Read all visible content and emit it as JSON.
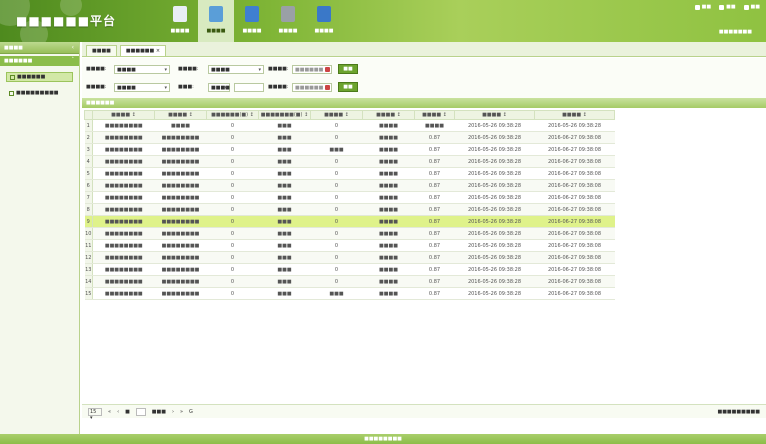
{
  "app": {
    "title": "■■■■■■平台"
  },
  "nav": [
    {
      "label": "■■■■",
      "icon": "document-icon",
      "color": "#e9eef6",
      "active": false
    },
    {
      "label": "■■■■",
      "icon": "bottles-icon",
      "color": "#5a9ed8",
      "active": true
    },
    {
      "label": "■■■■",
      "icon": "book-icon",
      "color": "#3f7fd0",
      "active": false
    },
    {
      "label": "■■■■",
      "icon": "gear-icon",
      "color": "#9aa0a6",
      "active": false
    },
    {
      "label": "■■■■",
      "icon": "shield-icon",
      "color": "#3a78c8",
      "active": false
    }
  ],
  "top_right": [
    {
      "label": "■■"
    },
    {
      "label": "■■"
    },
    {
      "label": "■■"
    }
  ],
  "user_info": "■■■■■■■",
  "sidebar": {
    "header": "■■■■",
    "sub": "■■■■■■",
    "items": [
      {
        "label": "■■■■■■",
        "active": true
      },
      {
        "label": "■■■■■■■■■",
        "active": false
      }
    ]
  },
  "tabs": [
    {
      "label": "■■■■",
      "active": false
    },
    {
      "label": "■■■■■■ ×",
      "active": true
    }
  ],
  "filters": {
    "row1": {
      "l1": "■■■■:",
      "v1": "■■■■",
      "l2": "■■■■:",
      "v2": "■■■■",
      "l3": "■■■■:",
      "p3": "■■■■■■",
      "btn": "■■"
    },
    "row2": {
      "l1": "■■■■:",
      "v1": "■■■■",
      "l2": "■■■:",
      "v2": "■■■■",
      "l3": "■■■■:",
      "p3": "■■■■■■",
      "btn": "■■"
    }
  },
  "section_title": "■■■■■■",
  "columns": [
    "■■■■ ↕",
    "■■■■ ↕",
    "■■■■■■(■) ↕",
    "■■■■■■■(■) ↕",
    "■■■■ ↕",
    "■■■■ ↕",
    "■■■■ ↕",
    "■■■■ ↕",
    "■■■■ ↕"
  ],
  "rows": [
    [
      "■■■■■■■■",
      "■■■■",
      "0",
      "■■■",
      "0",
      "■■■■",
      "■■■■",
      "2016-05-26 09:38:28",
      "2016-05-26 09:38:28"
    ],
    [
      "■■■■■■■■",
      "■■■■■■■■",
      "0",
      "■■■",
      "0",
      "■■■■",
      "0.87",
      "2016-05-26 09:38:28",
      "2016-06-27 09:38:08"
    ],
    [
      "■■■■■■■■",
      "■■■■■■■■",
      "0",
      "■■■",
      "■■■",
      "■■■■",
      "0.87",
      "2016-05-26 09:38:28",
      "2016-06-27 09:38:08"
    ],
    [
      "■■■■■■■■",
      "■■■■■■■■",
      "0",
      "■■■",
      "0",
      "■■■■",
      "0.87",
      "2016-05-26 09:38:28",
      "2016-06-27 09:38:08"
    ],
    [
      "■■■■■■■■",
      "■■■■■■■■",
      "0",
      "■■■",
      "0",
      "■■■■",
      "0.87",
      "2016-05-26 09:38:28",
      "2016-06-27 09:38:08"
    ],
    [
      "■■■■■■■■",
      "■■■■■■■■",
      "0",
      "■■■",
      "0",
      "■■■■",
      "0.87",
      "2016-05-26 09:38:28",
      "2016-06-27 09:38:08"
    ],
    [
      "■■■■■■■■",
      "■■■■■■■■",
      "0",
      "■■■",
      "0",
      "■■■■",
      "0.87",
      "2016-05-26 09:38:28",
      "2016-06-27 09:38:08"
    ],
    [
      "■■■■■■■■",
      "■■■■■■■■",
      "0",
      "■■■",
      "0",
      "■■■■",
      "0.87",
      "2016-05-26 09:38:28",
      "2016-06-27 09:38:08"
    ],
    [
      "■■■■■■■■",
      "■■■■■■■■",
      "0",
      "■■■",
      "0",
      "■■■■",
      "0.87",
      "2016-05-26 09:38:28",
      "2016-06-27 09:38:08"
    ],
    [
      "■■■■■■■■",
      "■■■■■■■■",
      "0",
      "■■■",
      "0",
      "■■■■",
      "0.87",
      "2016-05-26 09:38:28",
      "2016-06-27 09:38:08"
    ],
    [
      "■■■■■■■■",
      "■■■■■■■■",
      "0",
      "■■■",
      "0",
      "■■■■",
      "0.87",
      "2016-05-26 09:38:28",
      "2016-06-27 09:38:08"
    ],
    [
      "■■■■■■■■",
      "■■■■■■■■",
      "0",
      "■■■",
      "0",
      "■■■■",
      "0.87",
      "2016-05-26 09:38:28",
      "2016-06-27 09:38:08"
    ],
    [
      "■■■■■■■■",
      "■■■■■■■■",
      "0",
      "■■■",
      "0",
      "■■■■",
      "0.87",
      "2016-05-26 09:38:28",
      "2016-06-27 09:38:08"
    ],
    [
      "■■■■■■■■",
      "■■■■■■■■",
      "0",
      "■■■",
      "0",
      "■■■■",
      "0.87",
      "2016-05-26 09:38:28",
      "2016-06-27 09:38:08"
    ],
    [
      "■■■■■■■■",
      "■■■■■■■■",
      "0",
      "■■■",
      "■■■",
      "■■■■",
      "0.87",
      "2016-05-26 09:38:28",
      "2016-06-27 09:38:08"
    ]
  ],
  "selected_row": 8,
  "pager": {
    "size": "15",
    "first": "«",
    "prev": "‹",
    "page_label": "■",
    "page_suffix": "■■■",
    "next": "›",
    "last": "»",
    "refresh": "G",
    "info": "■■■■■■■■■"
  },
  "footer": "■■■■■■■■"
}
